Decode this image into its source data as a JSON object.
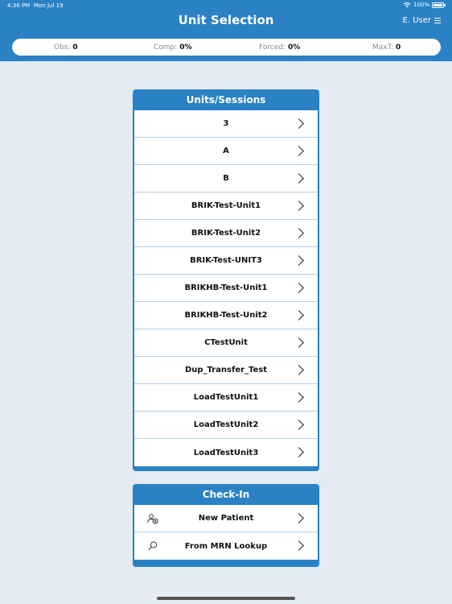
{
  "status_bar": {
    "time": "4:36 PM",
    "date": "Mon Jul 19",
    "battery": "100%"
  },
  "header": {
    "title": "Unit Selection",
    "user": "E. User"
  },
  "stats": {
    "obs_label": "Obs:",
    "obs_value": "0",
    "comp_label": "Comp:",
    "comp_value": "0%",
    "forced_label": "Forced:",
    "forced_value": "0%",
    "maxt_label": "MaxT:",
    "maxt_value": "0"
  },
  "units_panel": {
    "title": "Units/Sessions",
    "items": [
      "3",
      "A",
      "B",
      "BRIK-Test-Unit1",
      "BRIK-Test-Unit2",
      "BRIK-Test-UNIT3",
      "BRIKHB-Test-Unit1",
      "BRIKHB-Test-Unit2",
      "CTestUnit",
      "Dup_Transfer_Test",
      "LoadTestUnit1",
      "LoadTestUnit2",
      "LoadTestUnit3"
    ]
  },
  "checkin_panel": {
    "title": "Check-In",
    "items": [
      {
        "label": "New Patient",
        "icon": "add-person-icon"
      },
      {
        "label": "From MRN Lookup",
        "icon": "search-icon"
      }
    ]
  },
  "colors": {
    "brand": "#2a81c4",
    "background": "#e4ebf2",
    "divider": "#b8cee3"
  }
}
